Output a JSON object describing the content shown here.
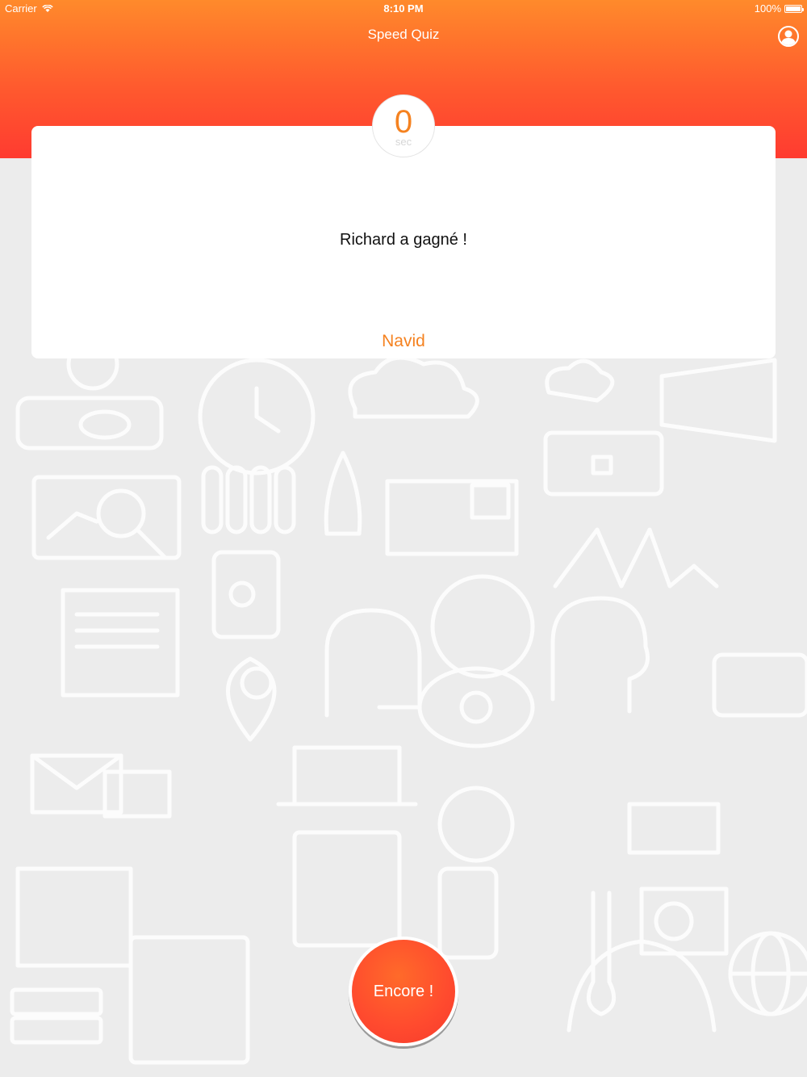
{
  "status_bar": {
    "carrier": "Carrier",
    "time": "8:10 PM",
    "battery": "100%"
  },
  "nav": {
    "title": "Speed Quiz",
    "profile_icon": "user-profile-icon"
  },
  "timer": {
    "value": "0",
    "unit": "sec"
  },
  "card": {
    "result": "Richard a gagné !",
    "player": "Navid"
  },
  "actions": {
    "encore_label": "Encore !"
  },
  "colors": {
    "accent": "#f58220",
    "header_top": "#ff8a2b",
    "header_bottom": "#ff3b30",
    "background": "#ececec"
  }
}
